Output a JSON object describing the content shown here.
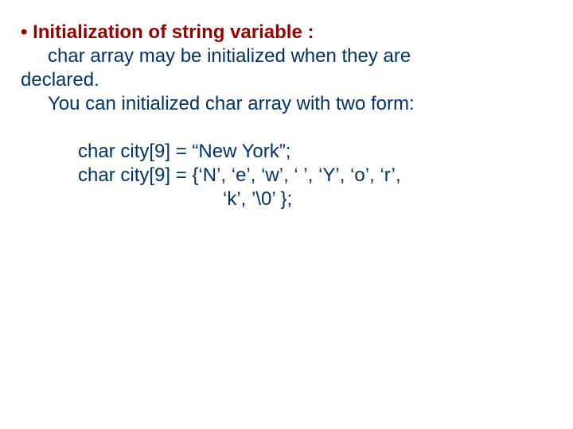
{
  "heading": {
    "bullet": "•",
    "text": "Initialization of string variable :"
  },
  "body": {
    "l1": "char array may be initialized when they are",
    "l2": "declared.",
    "l3": "You can initialized char array with two form:"
  },
  "code": {
    "l1": "char city[9] = “New York”;",
    "l2": "char city[9] = {‘N’, ‘e’, ‘w’, ‘ ’, ‘Y’, ‘o’, ‘r’,",
    "l3": "‘k’, ’\\0’ };"
  }
}
